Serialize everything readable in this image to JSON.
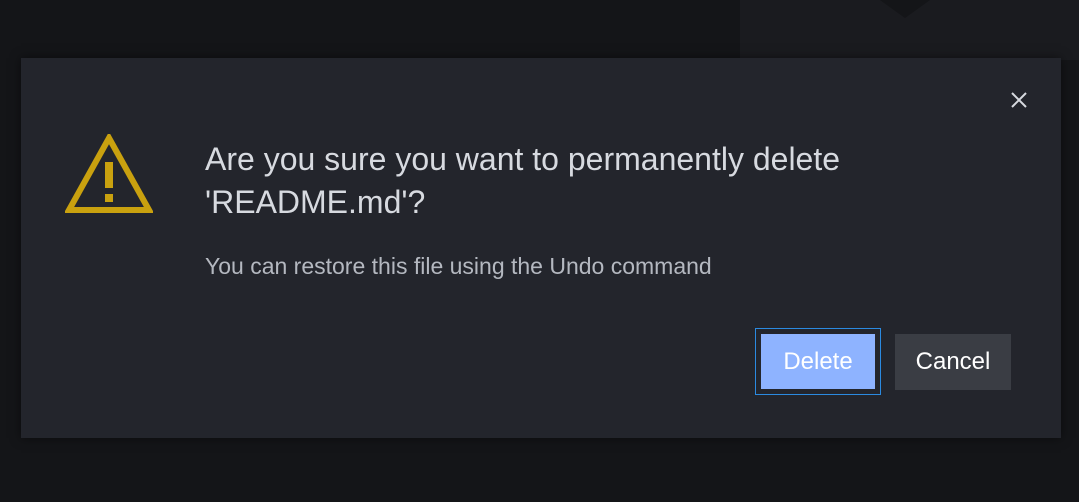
{
  "dialog": {
    "title": "Are you sure you want to permanently delete 'README.md'?",
    "message": "You can restore this file using the Undo command",
    "icon": "warning-icon",
    "close_icon": "close-icon",
    "buttons": {
      "delete_label": "Delete",
      "cancel_label": "Cancel"
    },
    "colors": {
      "warning": "#c9a10f",
      "primary": "#8eb3ff",
      "focus_ring": "#2b8ae0",
      "secondary": "#3a3d44"
    }
  }
}
